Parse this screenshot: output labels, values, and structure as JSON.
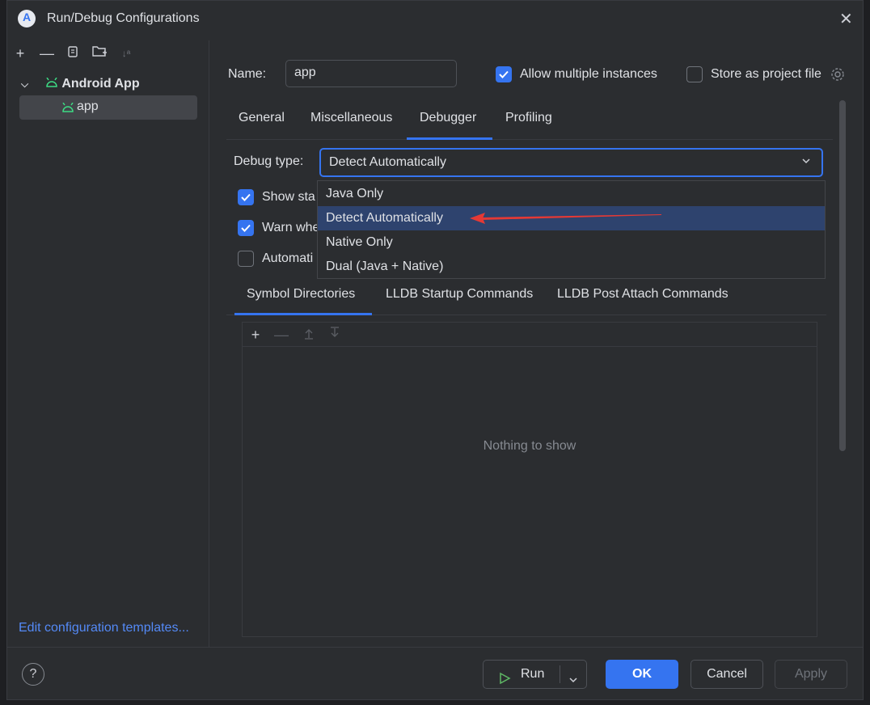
{
  "window": {
    "title": "Run/Debug Configurations"
  },
  "left_panel": {
    "toolbar": [
      "add-icon",
      "remove-icon",
      "copy-icon",
      "folder-add-icon",
      "sort-icon"
    ],
    "tree": {
      "root_label": "Android App",
      "item_label": "app"
    },
    "edit_templates_label": "Edit configuration templates..."
  },
  "form": {
    "name_label": "Name:",
    "name_value": "app",
    "allow_multiple_label": "Allow multiple instances",
    "allow_multiple_checked": true,
    "store_project_label": "Store as project file",
    "store_project_checked": false
  },
  "tabs": [
    {
      "label": "General"
    },
    {
      "label": "Miscellaneous"
    },
    {
      "label": "Debugger",
      "active": true
    },
    {
      "label": "Profiling"
    }
  ],
  "debugger": {
    "debug_type_label": "Debug type:",
    "selected": "Detect Automatically",
    "options": [
      "Java Only",
      "Detect Automatically",
      "Native Only",
      "Dual (Java + Native)"
    ],
    "checkbox_rows": [
      {
        "label": "Show sta",
        "checked": true
      },
      {
        "label": "Warn whe",
        "checked": true
      },
      {
        "label": "Automati",
        "checked": false
      }
    ]
  },
  "subtabs": [
    {
      "label": "Symbol Directories",
      "active": true
    },
    {
      "label": "LLDB Startup Commands"
    },
    {
      "label": "LLDB Post Attach Commands"
    }
  ],
  "symbol_panel": {
    "empty_text": "Nothing to show"
  },
  "footer": {
    "help_label": "?",
    "run_label": "Run",
    "ok_label": "OK",
    "cancel_label": "Cancel",
    "apply_label": "Apply"
  },
  "colors": {
    "accent": "#3574f0",
    "arrow": "#e53935",
    "android_green": "#3ddc84"
  }
}
